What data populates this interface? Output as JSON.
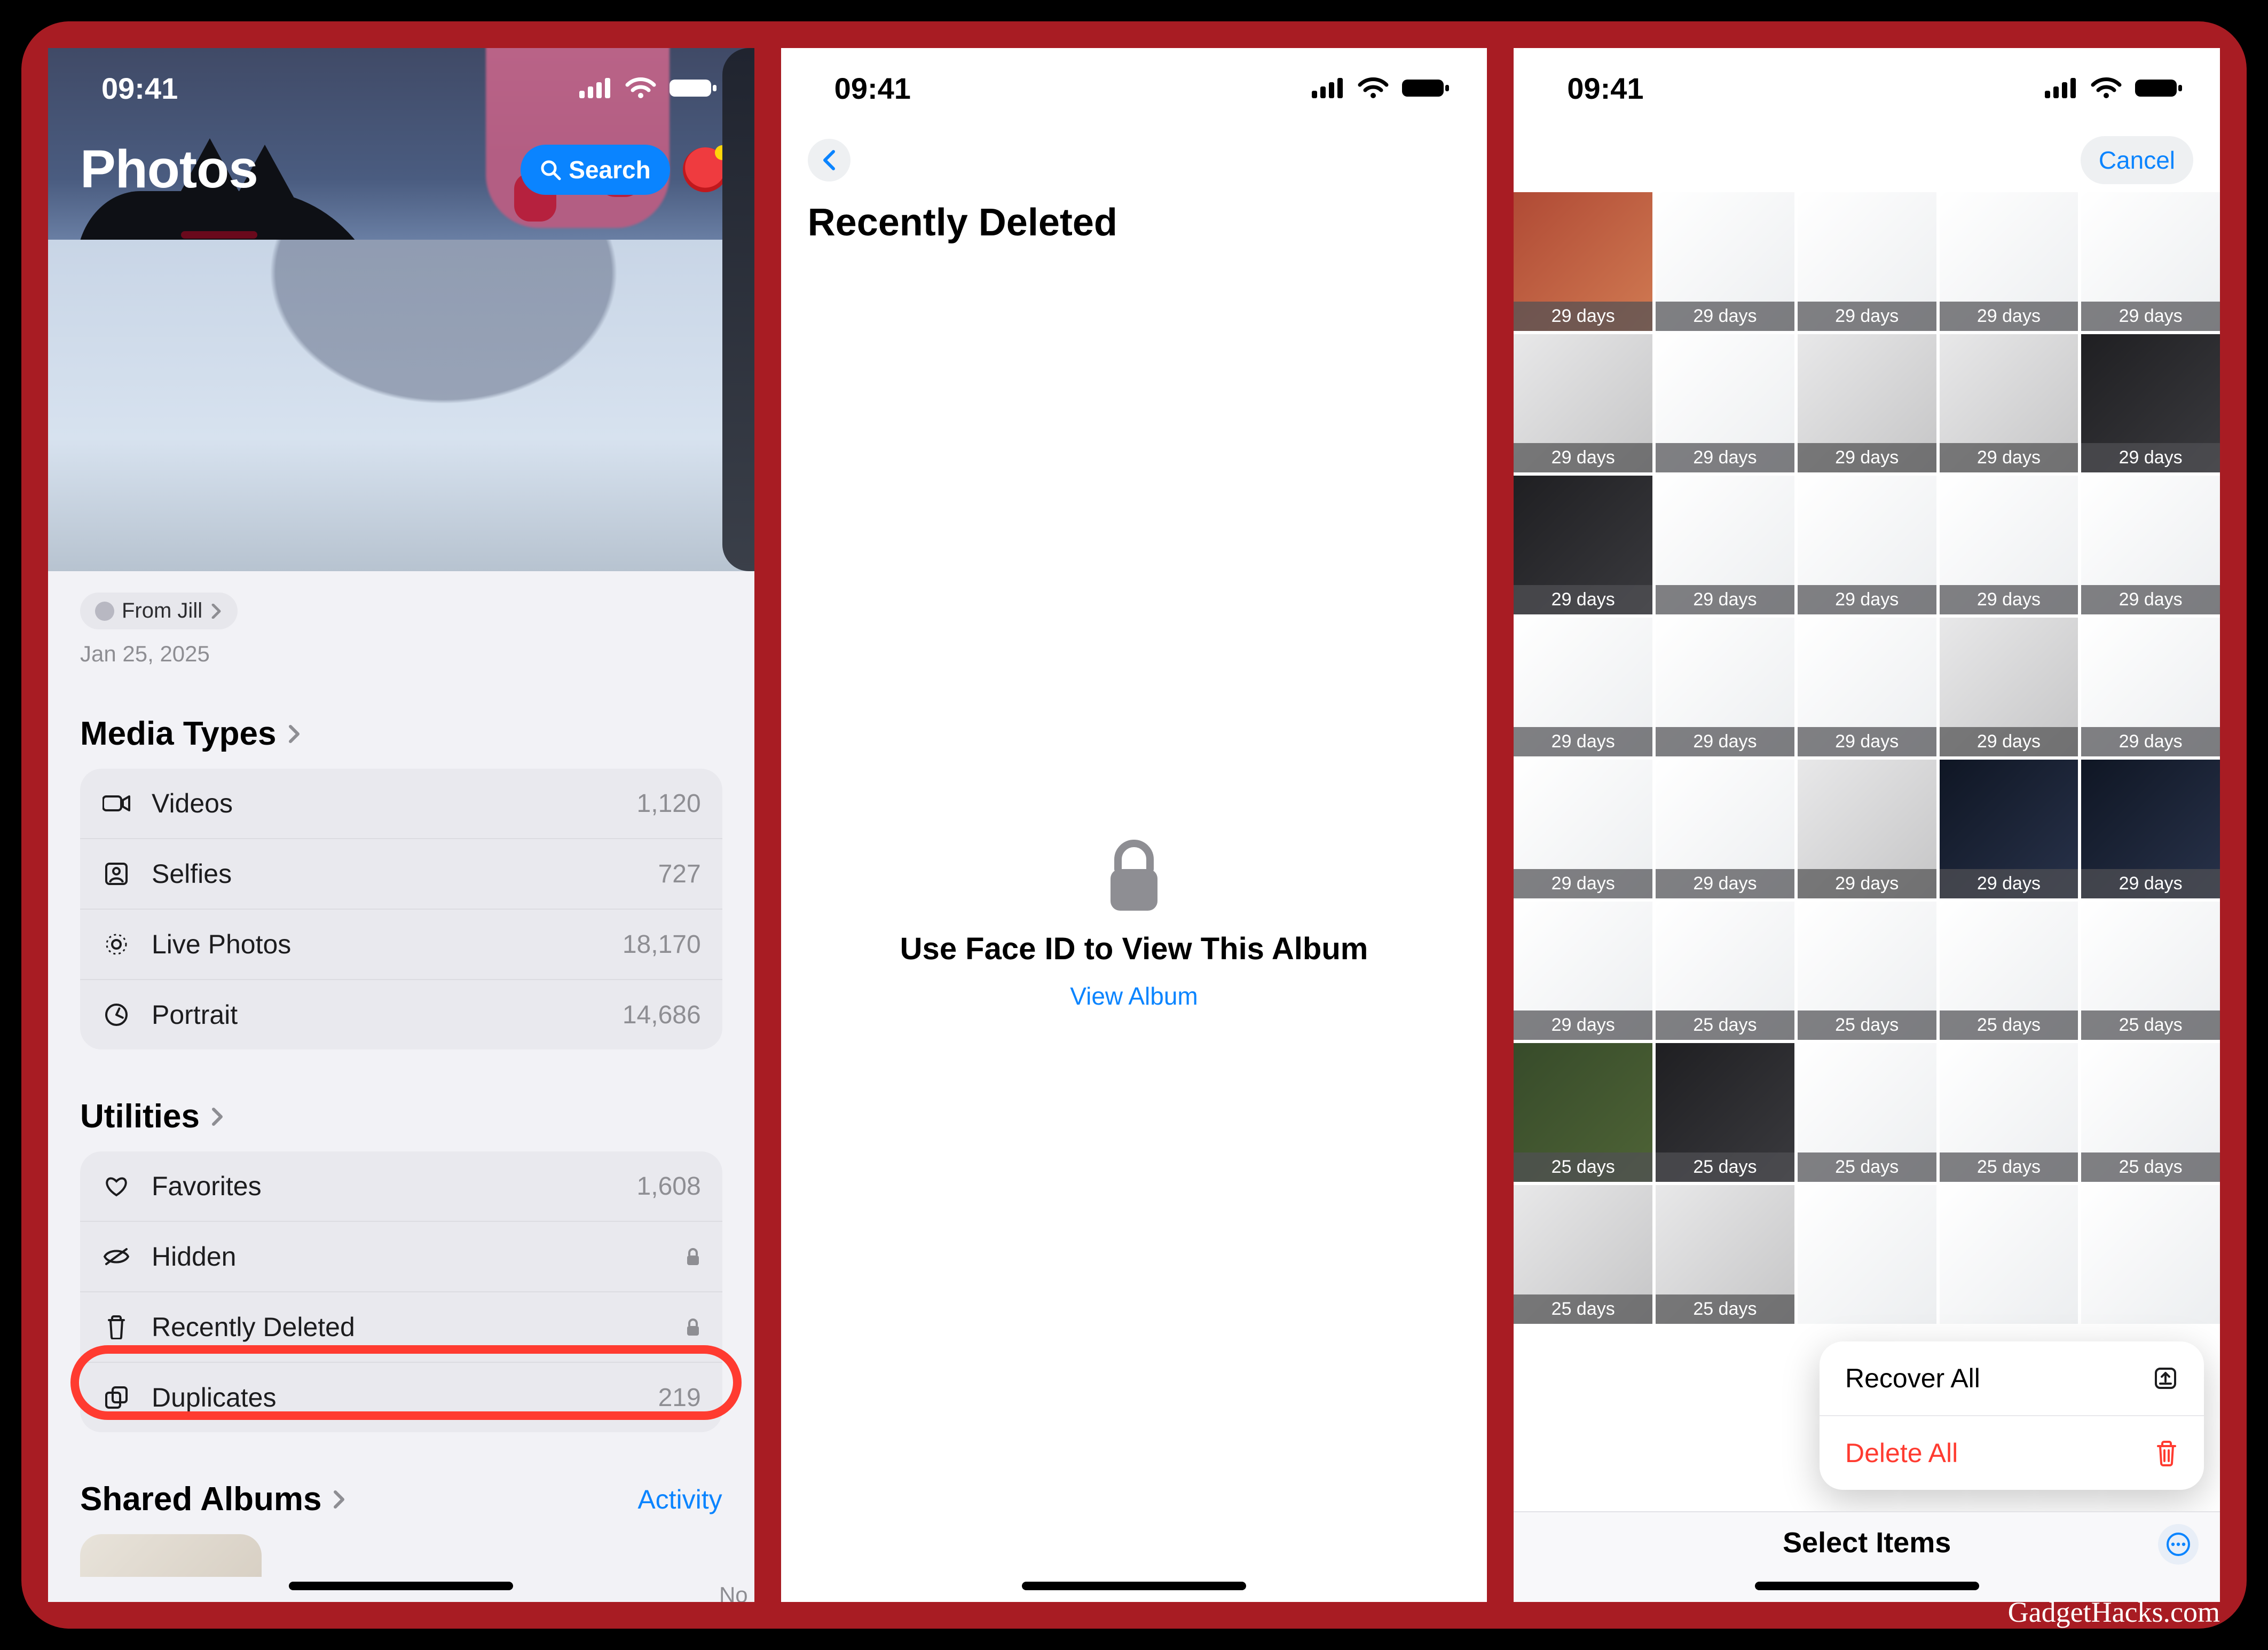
{
  "status": {
    "time": "09:41"
  },
  "credit": "GadgetHacks.com",
  "screen1": {
    "title": "Photos",
    "search_label": "Search",
    "from_pill": "From Jill",
    "date": "Jan 25, 2025",
    "next_peek_caption": "No",
    "sections": {
      "media_types": {
        "title": "Media Types",
        "rows": [
          {
            "icon": "video-icon",
            "label": "Videos",
            "count": "1,120"
          },
          {
            "icon": "selfie-icon",
            "label": "Selfies",
            "count": "727"
          },
          {
            "icon": "livephoto-icon",
            "label": "Live Photos",
            "count": "18,170"
          },
          {
            "icon": "portrait-icon",
            "label": "Portrait",
            "count": "14,686"
          }
        ]
      },
      "utilities": {
        "title": "Utilities",
        "rows": [
          {
            "icon": "heart-icon",
            "label": "Favorites",
            "count": "1,608",
            "locked": false
          },
          {
            "icon": "hidden-icon",
            "label": "Hidden",
            "count": "",
            "locked": true
          },
          {
            "icon": "trash-icon",
            "label": "Recently Deleted",
            "count": "",
            "locked": true
          },
          {
            "icon": "dup-icon",
            "label": "Duplicates",
            "count": "219",
            "locked": false
          }
        ]
      },
      "shared": {
        "title": "Shared Albums",
        "activity_label": "Activity"
      }
    }
  },
  "screen2": {
    "title": "Recently Deleted",
    "prompt": "Use Face ID to View This Album",
    "view_album": "View Album"
  },
  "screen3": {
    "cancel": "Cancel",
    "recover_all": "Recover All",
    "delete_all": "Delete All",
    "select_items": "Select Items",
    "tiles": [
      [
        "29 days",
        "29 days",
        "29 days",
        "29 days",
        "29 days"
      ],
      [
        "29 days",
        "29 days",
        "29 days",
        "29 days",
        "29 days"
      ],
      [
        "29 days",
        "29 days",
        "29 days",
        "29 days",
        "29 days"
      ],
      [
        "29 days",
        "29 days",
        "29 days",
        "29 days",
        "29 days"
      ],
      [
        "29 days",
        "29 days",
        "29 days",
        "29 days",
        "29 days"
      ],
      [
        "29 days",
        "25 days",
        "25 days",
        "25 days",
        "25 days"
      ],
      [
        "25 days",
        "25 days",
        "25 days",
        "25 days",
        "25 days"
      ],
      [
        "25 days",
        "25 days",
        "",
        "",
        ""
      ]
    ]
  }
}
